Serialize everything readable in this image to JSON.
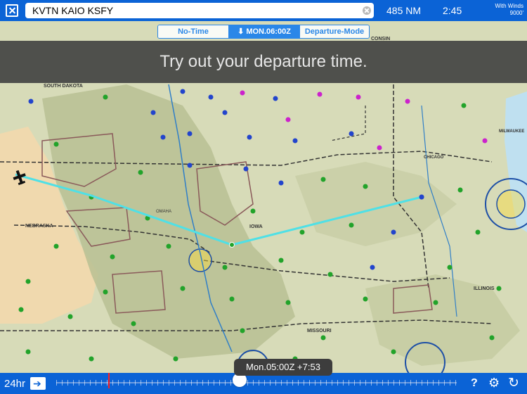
{
  "topbar": {
    "route": "KVTN KAIO KSFY",
    "distance": "485 NM",
    "ete": "2:45",
    "winds_line1": "With Winds",
    "winds_line2": "9000'"
  },
  "mode_tabs": [
    {
      "label": "No-Time",
      "selected": false
    },
    {
      "label": "⬇ MON.06:00Z",
      "selected": true
    },
    {
      "label": "Departure-Mode",
      "selected": false
    }
  ],
  "hint": "Try out your departure time.",
  "map": {
    "labels": {
      "south_dakota": "SOUTH DAKOTA",
      "nebraska": "NEBRASKA",
      "iowa": "IOWA",
      "missouri": "MISSOURI",
      "illinois": "ILLINOIS",
      "wisconsin": "CONSIN",
      "chicago": "CHICAGO",
      "milwaukee": "MILWAUKEE",
      "omaha": "OMAHA"
    },
    "colors": {
      "route": "#4fe0e6",
      "terrain": "#b9bf93",
      "plain": "#d7dbb8",
      "west": "#f0d9ae"
    }
  },
  "bottombar": {
    "range": "24hr",
    "time_label": "Mon.05:00Z +7:53",
    "help": "?",
    "gear_icon": "gear-icon",
    "refresh_icon": "refresh-icon"
  }
}
